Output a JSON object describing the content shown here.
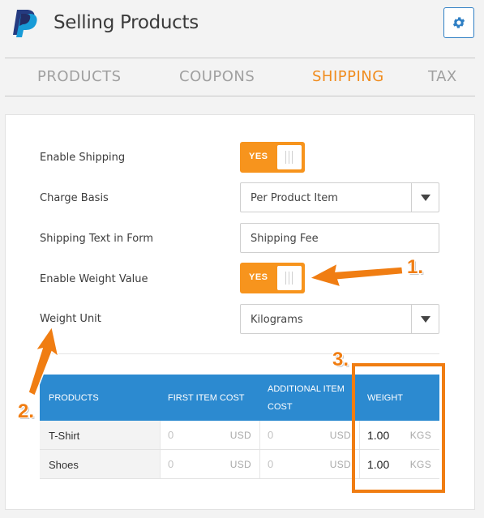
{
  "header": {
    "title": "Selling Products",
    "logo_icon": "paypal-logo",
    "settings_icon": "gear-icon",
    "brand_color": "#2f7fc4"
  },
  "tabs": [
    {
      "label": "PRODUCTS",
      "active": false
    },
    {
      "label": "COUPONS",
      "active": false
    },
    {
      "label": "SHIPPING",
      "active": true
    },
    {
      "label": "TAX",
      "active": false
    }
  ],
  "accent_color": "#f7941d",
  "form": {
    "enable_shipping": {
      "label": "Enable Shipping",
      "value": "YES"
    },
    "charge_basis": {
      "label": "Charge Basis",
      "value": "Per Product Item"
    },
    "shipping_text": {
      "label": "Shipping Text in Form",
      "value": "Shipping Fee"
    },
    "enable_weight": {
      "label": "Enable Weight Value",
      "value": "YES"
    },
    "weight_unit": {
      "label": "Weight Unit",
      "value": "Kilograms"
    }
  },
  "table": {
    "headers": [
      "PRODUCTS",
      "FIRST ITEM COST",
      "ADDITIONAL ITEM",
      "COST",
      "WEIGHT"
    ],
    "rows": [
      {
        "name": "T-Shirt",
        "first_cost": "0",
        "first_unit": "USD",
        "add_cost": "0",
        "add_unit": "USD",
        "weight": "1.00",
        "weight_unit": "KGS"
      },
      {
        "name": "Shoes",
        "first_cost": "0",
        "first_unit": "USD",
        "add_cost": "0",
        "add_unit": "USD",
        "weight": "1.00",
        "weight_unit": "KGS"
      }
    ]
  },
  "annotations": {
    "marker1": "1.",
    "marker2": "2.",
    "marker3": "3."
  }
}
